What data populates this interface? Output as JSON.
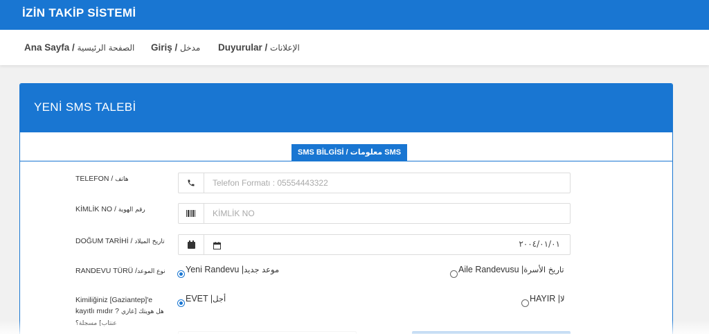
{
  "app": {
    "title": "İZİN TAKİP SİSTEMİ"
  },
  "nav": {
    "items": [
      {
        "label": "Ana Sayfa / ",
        "label_ar": "الصفحة الرئيسية"
      },
      {
        "label": "Giriş / ",
        "label_ar": "مدخل"
      },
      {
        "label": "Duyurular / ",
        "label_ar": "الإعلانات"
      }
    ]
  },
  "card": {
    "title": "YENİ SMS TALEBİ",
    "tab_label": "SMS BİLGİSİ / معلومات SMS"
  },
  "form": {
    "phone": {
      "label": "TELEFON / ",
      "label_ar": "هاتف",
      "placeholder": "Telefon Formatı : 05554443322",
      "icon": "phone-icon"
    },
    "id_no": {
      "label": "KİMLİK NO / ",
      "label_ar": "رقم الهوية",
      "placeholder": "KİMLİK NO",
      "icon": "barcode-icon"
    },
    "birth_date": {
      "label": "DOĞUM TARİHİ / ",
      "label_ar": "تاريخ الميلاد",
      "value": "٢٠٠٤/٠١/٠١",
      "icon": "calendar-icon"
    },
    "appointment_type": {
      "label": "RANDEVU TÜRÜ /",
      "label_ar": "نوع الموعد",
      "options": [
        {
          "label": "Yeni Randevu | ",
          "label_ar": "موعد جديد",
          "selected": true
        },
        {
          "label": "Aile Randevusu | ",
          "label_ar": "تاريخ الأسرة",
          "selected": false
        }
      ]
    },
    "registered": {
      "label": "Kimiliğiniz [Gaziantep]'e kayıtlı mıdır ? ",
      "label_ar": "هل هويتك [غازي عنتاب] مسجلة؟",
      "options": [
        {
          "label": "EVET | ",
          "label_ar": "أجل",
          "selected": true
        },
        {
          "label": "HAYIR | ",
          "label_ar": "لا",
          "selected": false
        }
      ]
    }
  },
  "colors": {
    "primary": "#1976d2",
    "background": "#f1f1f1"
  }
}
